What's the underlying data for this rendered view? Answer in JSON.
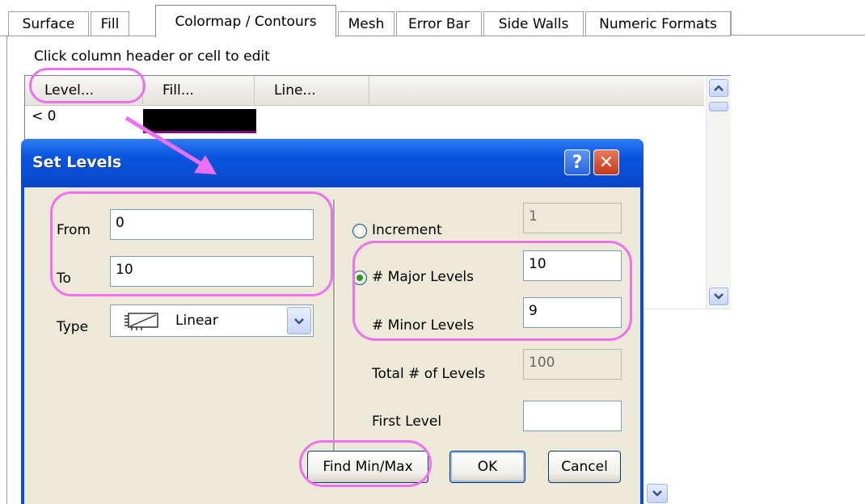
{
  "tabs": [
    "Surface",
    "Fill",
    "Colormap / Contours",
    "Mesh",
    "Error Bar",
    "Side Walls",
    "Numeric Formats"
  ],
  "active_tab": "Colormap / Contours",
  "hint": "Click column header or cell to edit",
  "grid": {
    "headers": [
      "Level...",
      "Fill...",
      "Line..."
    ],
    "first_row_label": "< 0",
    "fill_color": "#000000"
  },
  "dialog": {
    "title": "Set Levels",
    "help_label": "?",
    "close_label": "✕",
    "from_label": "From",
    "from_value": "0",
    "to_label": "To",
    "to_value": "10",
    "type_label": "Type",
    "type_value": "Linear",
    "increment_label": "Increment",
    "increment_value": "1",
    "major_label": "# Major Levels",
    "major_value": "10",
    "minor_label": "# Minor Levels",
    "minor_value": "9",
    "total_label": "Total # of Levels",
    "total_value": "100",
    "first_label": "First Level",
    "first_value": "",
    "find_label": "Find Min/Max",
    "ok_label": "OK",
    "cancel_label": "Cancel",
    "selected_radio": "major"
  },
  "colors": {
    "annotation": "#f06ef0",
    "titlebar": "#0a56e0",
    "dialog_bg": "#ece9d8"
  }
}
